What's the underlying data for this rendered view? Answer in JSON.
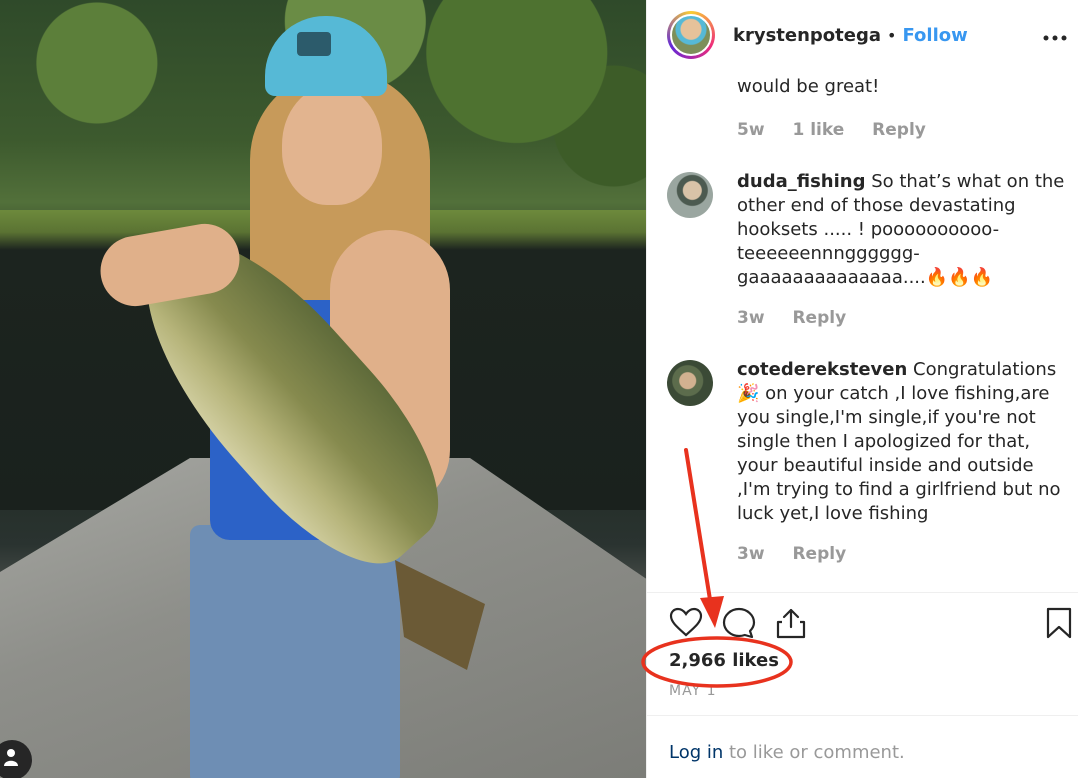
{
  "post": {
    "username": "krystenpotega",
    "dot": "•",
    "follow_label": "Follow",
    "more": "•••"
  },
  "comments": {
    "truncated_text": "would be great!",
    "first_meta": {
      "time": "5w",
      "likes": "1 like",
      "reply": "Reply"
    },
    "items": [
      {
        "author": "duda_fishing",
        "text": " So that’s what on the other end of those devastating hooksets ..... ! poooooooooo-teeeeeennngggggg-gaaaaaaaaaaaaaa....🔥🔥🔥",
        "time": "3w",
        "reply": "Reply"
      },
      {
        "author": "cotedereksteven",
        "text": " Congratulations 🎉 on your catch ,I love fishing,are you single,I'm single,if you're not single then I apologized for that, your beautiful inside and outside ,I'm trying to find a girlfriend but no luck yet,I love fishing",
        "time": "3w",
        "reply": "Reply"
      }
    ]
  },
  "footer": {
    "likes": "2,966 likes",
    "date": "MAY 1",
    "login_link": "Log in",
    "login_suffix": " to like or comment."
  },
  "icons": {
    "like": "heart-icon",
    "comment": "comment-icon",
    "share": "share-icon",
    "save": "bookmark-icon",
    "user": "user-tag-icon"
  },
  "colors": {
    "link": "#3897f0",
    "annotation": "#e8321e",
    "muted": "#999999"
  }
}
